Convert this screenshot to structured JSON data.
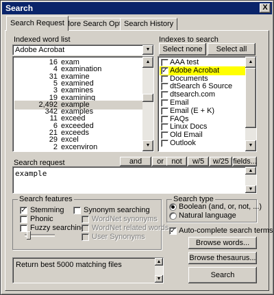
{
  "window": {
    "title": "Search",
    "close_glyph": "X"
  },
  "tabs": [
    "Search Request",
    "More Search Options",
    "Search History"
  ],
  "word_list": {
    "label": "Indexed word list",
    "input_value": "Adobe Acrobat",
    "rows": [
      {
        "count": "16",
        "word": "exam"
      },
      {
        "count": "4",
        "word": "examination"
      },
      {
        "count": "31",
        "word": "examine"
      },
      {
        "count": "5",
        "word": "examined"
      },
      {
        "count": "3",
        "word": "examines"
      },
      {
        "count": "19",
        "word": "examining"
      },
      {
        "count": "2,492",
        "word": "example"
      },
      {
        "count": "342",
        "word": "examples"
      },
      {
        "count": "11",
        "word": "exceed"
      },
      {
        "count": "6",
        "word": "exceeded"
      },
      {
        "count": "21",
        "word": "exceeds"
      },
      {
        "count": "29",
        "word": "excel"
      },
      {
        "count": "2",
        "word": "excenviron"
      }
    ],
    "selected_word": "example"
  },
  "indexes": {
    "label": "Indexes to search",
    "select_none": "Select none",
    "select_all": "Select all",
    "items": [
      {
        "name": "AAA test",
        "checked": false
      },
      {
        "name": "Adobe Acrobat",
        "checked": true
      },
      {
        "name": "Documents",
        "checked": false
      },
      {
        "name": "dtSearch 6 Source",
        "checked": false
      },
      {
        "name": "dtsearch.com",
        "checked": false
      },
      {
        "name": "Email",
        "checked": false
      },
      {
        "name": "Email (E + K)",
        "checked": false
      },
      {
        "name": "FAQs",
        "checked": false
      },
      {
        "name": "Linux Docs",
        "checked": false
      },
      {
        "name": "Old Email",
        "checked": false
      },
      {
        "name": "Outlook",
        "checked": false
      }
    ]
  },
  "search_request": {
    "label": "Search request",
    "value": "example",
    "operators": [
      "and",
      "or",
      "not",
      "w/5",
      "w/25",
      "fields..."
    ]
  },
  "features": {
    "title": "Search features",
    "stemming": "Stemming",
    "phonic": "Phonic",
    "fuzzy": "Fuzzy searching",
    "synonym": "Synonym searching",
    "wordnet_synonyms": "WordNet synonyms",
    "wordnet_related": "WordNet related words",
    "user_synonyms": "User Synonyms"
  },
  "search_type": {
    "title": "Search type",
    "boolean": "Boolean (and, or, not, ...)",
    "natural": "Natural language"
  },
  "autocomplete": "Auto-complete search terms",
  "browse_words": "Browse words...",
  "browse_thesaurus": "Browse thesaurus...",
  "status_text": "Return best 5000 matching files",
  "search_button": "Search"
}
